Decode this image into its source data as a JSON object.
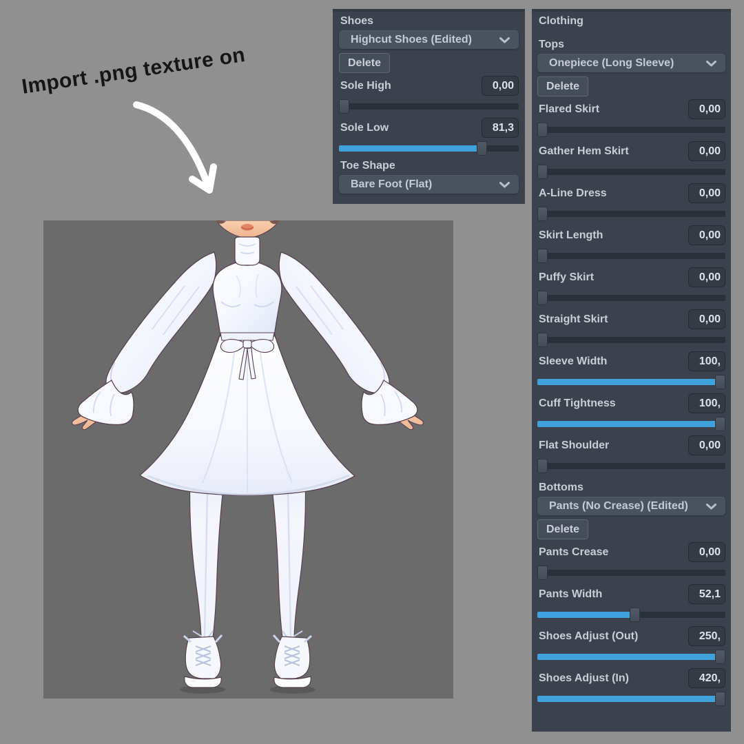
{
  "annotation": {
    "text": "Import .png texture on"
  },
  "icons": {
    "dropdown_chevron": "chevron-down",
    "annotation_arrow": "curved-arrow-down-right"
  },
  "colors": {
    "page_bg": "#909090",
    "viewport_bg": "#6b6b6b",
    "panel_bg": "#3b424d",
    "accent_blue": "#3fa2dc",
    "annotation_text": "#161616",
    "arrow": "#ffffff"
  },
  "character_viewport": {
    "description": "3D avatar preview: white long-sleeve onepiece dress, white pants, white highcut shoes"
  },
  "shoes_panel": {
    "title": "Shoes",
    "preset_dropdown": "Highcut Shoes (Edited)",
    "delete_label": "Delete",
    "params": [
      {
        "label": "Sole High",
        "value": "0,00",
        "percent": 0
      },
      {
        "label": "Sole Low",
        "value": "81,3",
        "percent": 81.3
      }
    ],
    "toe_shape": {
      "label": "Toe Shape",
      "dropdown": "Bare Foot (Flat)"
    }
  },
  "clothing_panel": {
    "title": "Clothing",
    "tops": {
      "label": "Tops",
      "preset_dropdown": "Onepiece (Long Sleeve)",
      "delete_label": "Delete",
      "params": [
        {
          "label": "Flared Skirt",
          "value": "0,00",
          "percent": 0
        },
        {
          "label": "Gather Hem Skirt",
          "value": "0,00",
          "percent": 0
        },
        {
          "label": "A-Line Dress",
          "value": "0,00",
          "percent": 0
        },
        {
          "label": "Skirt Length",
          "value": "0,00",
          "percent": 0
        },
        {
          "label": "Puffy Skirt",
          "value": "0,00",
          "percent": 0
        },
        {
          "label": "Straight Skirt",
          "value": "0,00",
          "percent": 0
        },
        {
          "label": "Sleeve Width",
          "value": "100,",
          "percent": 100
        },
        {
          "label": "Cuff Tightness",
          "value": "100,",
          "percent": 100
        },
        {
          "label": "Flat Shoulder",
          "value": "0,00",
          "percent": 0
        }
      ]
    },
    "bottoms": {
      "label": "Bottoms",
      "preset_dropdown": "Pants (No Crease) (Edited)",
      "delete_label": "Delete",
      "params": [
        {
          "label": "Pants Crease",
          "value": "0,00",
          "percent": 0
        },
        {
          "label": "Pants Width",
          "value": "52,1",
          "percent": 52.1
        },
        {
          "label": "Shoes Adjust (Out)",
          "value": "250,",
          "percent": 100
        },
        {
          "label": "Shoes Adjust (In)",
          "value": "420,",
          "percent": 100
        }
      ]
    }
  }
}
